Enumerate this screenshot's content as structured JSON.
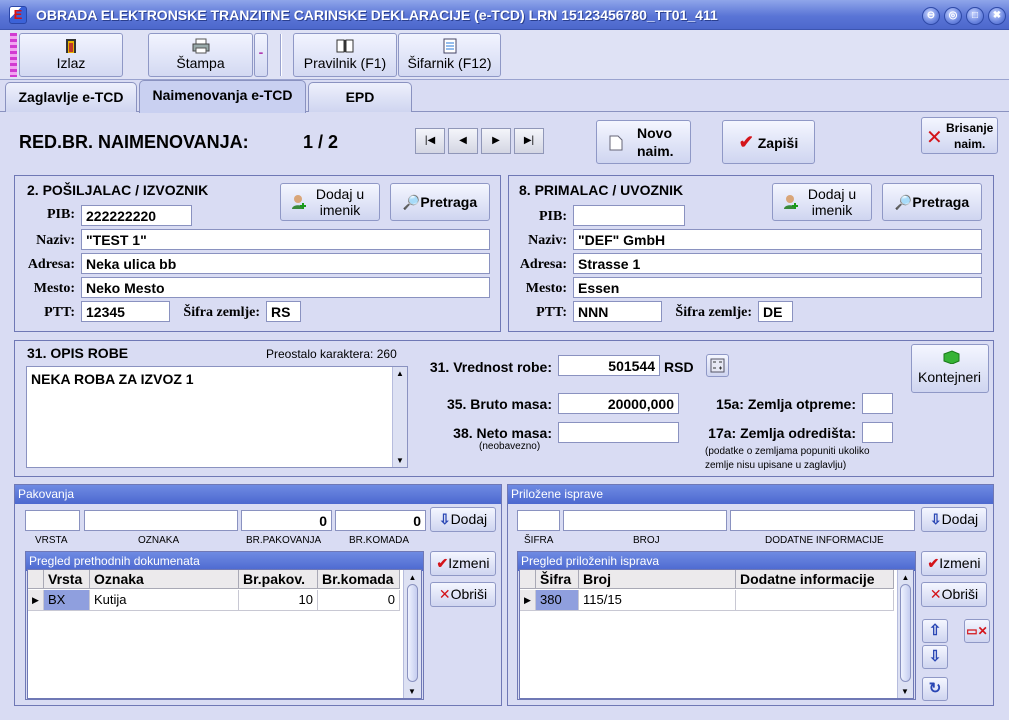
{
  "window": {
    "title": "OBRADA ELEKTRONSKE TRANZITNE CARINSKE DEKLARACIJE (e-TCD)  LRN 15123456780_TT01_411",
    "controls": [
      "⊖",
      "◎",
      "□",
      "✖"
    ]
  },
  "toolbar": {
    "izlaz": "Izlaz",
    "stampa": "Štampa",
    "stampa_menu": "-",
    "pravilnik": "Pravilnik (F1)",
    "sifarnik": "Šifarnik (F12)"
  },
  "tabs": [
    "Zaglavlje e-TCD",
    "Naimenovanja e-TCD",
    "EPD"
  ],
  "header": {
    "label": "RED.BR. NAIMENOVANJA:",
    "counter": "1 / 2",
    "nav": [
      "|◀",
      "◀",
      "▶",
      "▶|"
    ],
    "novo_line1": "Novo",
    "novo_line2": "naim.",
    "zapisi": "Zapiši",
    "brisanje_line1": "Brisanje",
    "brisanje_line2": "naim."
  },
  "posiljalac": {
    "title": "2. POŠILJALAC / IZVOZNIK",
    "pib_label": "PIB:",
    "pib": "222222220",
    "naziv_label": "Naziv:",
    "naziv": "\"TEST 1\"",
    "adresa_label": "Adresa:",
    "adresa": "Neka ulica bb",
    "mesto_label": "Mesto:",
    "mesto": "Neko Mesto",
    "ptt_label": "PTT:",
    "ptt": "12345",
    "sifra_label": "Šifra zemlje:",
    "sifra": "RS",
    "dodaj_line1": "Dodaj u",
    "dodaj_line2": "imenik",
    "pretraga": "Pretraga"
  },
  "primalac": {
    "title": "8. PRIMALAC / UVOZNIK",
    "pib_label": "PIB:",
    "pib": "",
    "naziv_label": "Naziv:",
    "naziv": "\"DEF\" GmbH",
    "adresa_label": "Adresa:",
    "adresa": "Strasse 1",
    "mesto_label": "Mesto:",
    "mesto": "Essen",
    "ptt_label": "PTT:",
    "ptt": "NNN",
    "sifra_label": "Šifra zemlje:",
    "sifra": "DE",
    "dodaj_line1": "Dodaj u",
    "dodaj_line2": "imenik",
    "pretraga": "Pretraga"
  },
  "opis": {
    "title": "31. OPIS ROBE",
    "remaining_label": "Preostalo karaktera: 260",
    "text": "NEKA ROBA ZA IZVOZ 1"
  },
  "roba": {
    "vrednost_label": "31. Vrednost robe:",
    "vrednost": "501544",
    "valuta": "RSD",
    "bruto_label": "35. Bruto masa:",
    "bruto": "20000,000",
    "neto_label": "38. Neto masa:",
    "neto": "",
    "neto_note": "(neobavezno)",
    "otpreme_label": "15a: Zemlja otpreme:",
    "otpreme": "",
    "odredista_label": "17a: Zemlja odredišta:",
    "odredista": "",
    "note_line1": "(podatke o zemljama popuniti ukoliko",
    "note_line2": "zemlje nisu upisane u zaglavlju)",
    "kontejneri": "Kontejneri"
  },
  "pakovanja": {
    "title": "Pakovanja",
    "vrsta": "",
    "oznaka": "",
    "br_pakovanja": "0",
    "br_komada": "0",
    "lbl_vrsta": "VRSTA",
    "lbl_oznaka": "OZNAKA",
    "lbl_brpak": "BR.PAKOVANJA",
    "lbl_brkom": "BR.KOMADA",
    "dodaj": "Dodaj",
    "grid_title": "Pregled prethodnih dokumenata",
    "columns": [
      "Vrsta",
      "Oznaka",
      "Br.pakov.",
      "Br.komada"
    ],
    "rows": [
      {
        "vrsta": "BX",
        "oznaka": "Kutija",
        "brpak": "10",
        "brkom": "0"
      }
    ],
    "izmeni": "Izmeni",
    "obrisi": "Obriši"
  },
  "isprave": {
    "title": "Priložene isprave",
    "sifra": "",
    "broj": "",
    "dodatne": "",
    "lbl_sifra": "ŠIFRA",
    "lbl_broj": "BROJ",
    "lbl_dodatne": "DODATNE INFORMACIJE",
    "dodaj": "Dodaj",
    "grid_title": "Pregled priloženih isprava",
    "columns": [
      "Šifra",
      "Broj",
      "Dodatne informacije"
    ],
    "rows": [
      {
        "sifra": "380",
        "broj": "115/15",
        "dodatne": ""
      }
    ],
    "izmeni": "Izmeni",
    "obrisi": "Obriši"
  }
}
